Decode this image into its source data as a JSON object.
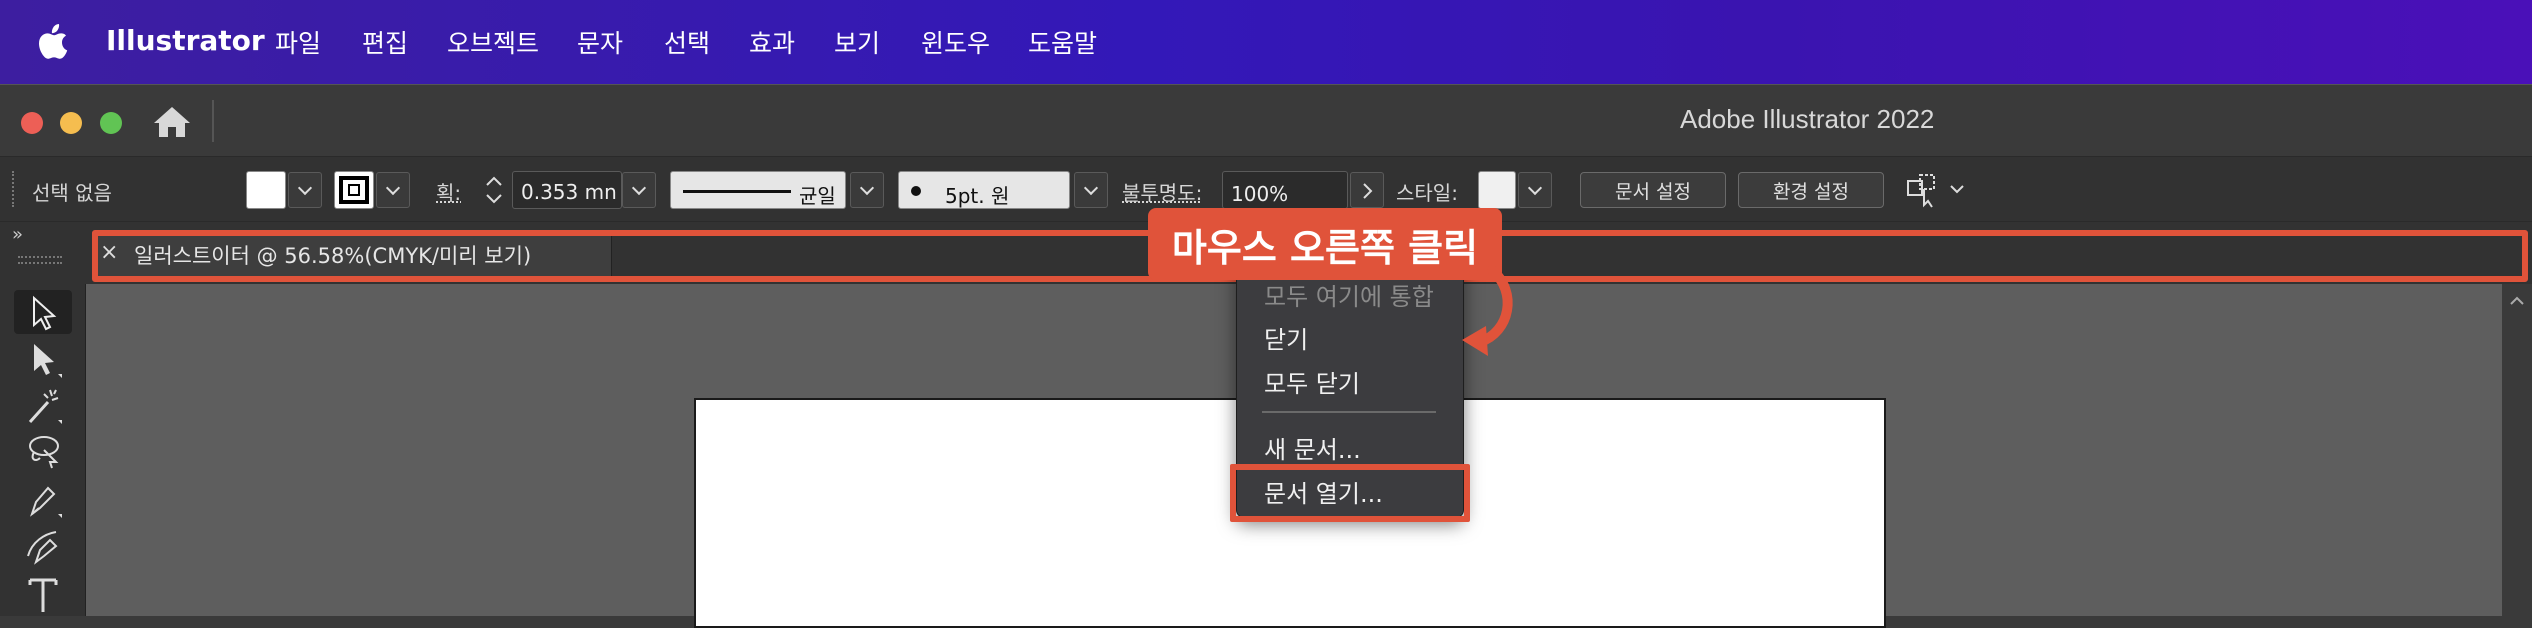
{
  "menubar": {
    "app_name": "Illustrator",
    "items": [
      "파일",
      "편집",
      "오브젝트",
      "문자",
      "선택",
      "효과",
      "보기",
      "윈도우",
      "도움말"
    ]
  },
  "window": {
    "title": "Adobe Illustrator 2022"
  },
  "control_bar": {
    "selection_label": "선택 없음",
    "stroke_label": "획:",
    "stroke_value": "0.353 mn",
    "profile_label": "균일",
    "brush_label": "5pt. 원",
    "opacity_label": "불투명도:",
    "opacity_value": "100%",
    "style_label": "스타일:",
    "doc_setup_button": "문서 설정",
    "preferences_button": "환경 설정"
  },
  "tab": {
    "close_glyph": "×",
    "label": "일러스트이터 @ 56.58%(CMYK/미리 보기)",
    "collapse_glyph": "»"
  },
  "context_menu": {
    "items": [
      {
        "label": "모두 여기에 통합",
        "enabled": false
      },
      {
        "label": "닫기",
        "enabled": true
      },
      {
        "label": "모두 닫기",
        "enabled": true
      },
      {
        "label": "새 문서...",
        "enabled": true
      },
      {
        "label": "문서 열기...",
        "enabled": true,
        "highlighted": true
      }
    ]
  },
  "callout": {
    "text": "마우스 오른쪽 클릭"
  },
  "colors": {
    "accent": "#e0533a",
    "menubar_start": "#3d1ea0",
    "menubar_end": "#4a10b8",
    "traffic_red": "#ed5f56",
    "traffic_yellow": "#f5bd4f",
    "traffic_green": "#61c454"
  },
  "icons": [
    "apple-icon",
    "home-icon",
    "selection-tool-icon",
    "direct-selection-tool-icon",
    "magic-wand-icon",
    "lasso-icon",
    "pen-icon",
    "curvature-icon",
    "type-icon",
    "align-icon"
  ]
}
